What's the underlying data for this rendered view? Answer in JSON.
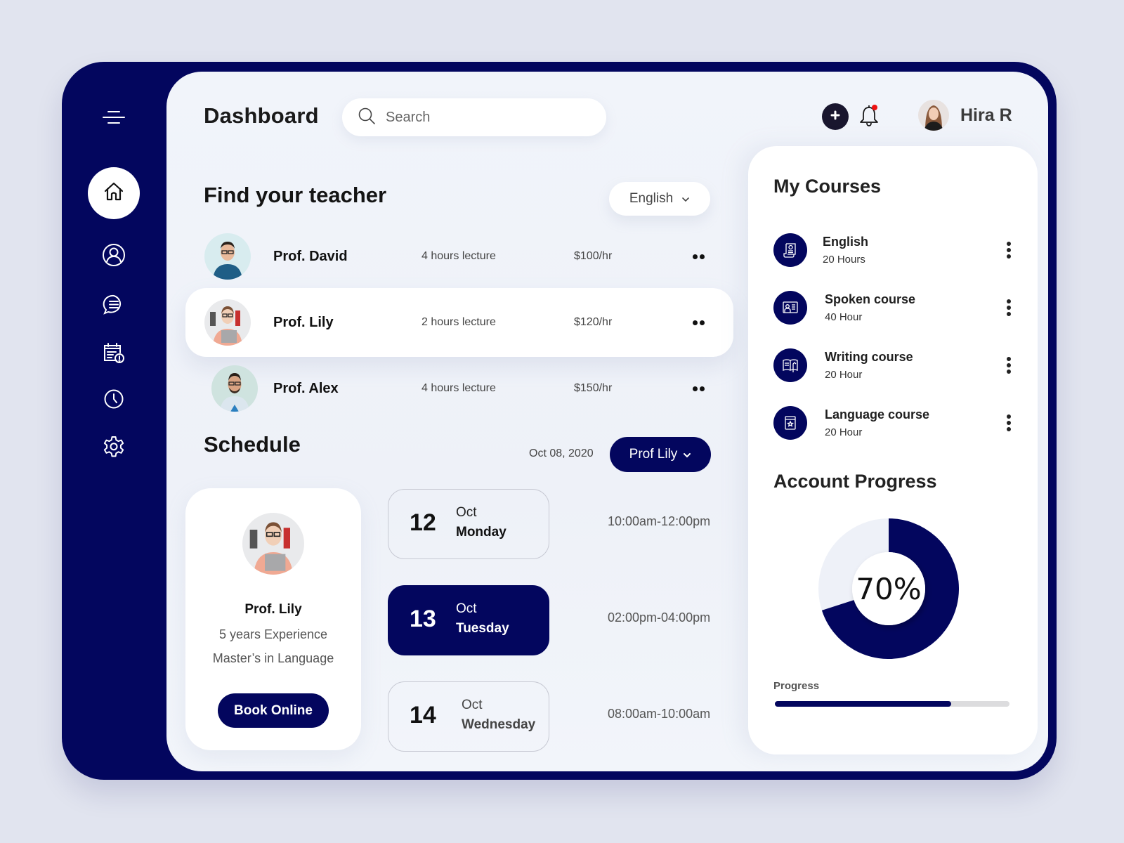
{
  "app": {
    "title": "Dashboard",
    "accent_color": "#03065e",
    "notification_color": "#ee1111"
  },
  "sidebar": {
    "items": [
      {
        "name": "menu",
        "icon": "hamburger-menu-icon"
      },
      {
        "name": "home",
        "icon": "home-icon",
        "active": true
      },
      {
        "name": "profile",
        "icon": "user-circle-icon"
      },
      {
        "name": "messages",
        "icon": "chat-bubble-icon"
      },
      {
        "name": "calendar",
        "icon": "calendar-info-icon"
      },
      {
        "name": "history",
        "icon": "clock-icon"
      },
      {
        "name": "settings",
        "icon": "gear-icon"
      }
    ]
  },
  "header": {
    "search_placeholder": "Search",
    "add_icon": "plus-icon",
    "notification_icon": "bell-icon",
    "user_name": "Hira R"
  },
  "teachers": {
    "title": "Find your teacher",
    "language_filter": "English",
    "list": [
      {
        "name": "Prof. David",
        "lecture": "4 hours lecture",
        "rate": "$100/hr",
        "active": false
      },
      {
        "name": "Prof. Lily",
        "lecture": "2 hours lecture",
        "rate": "$120/hr",
        "active": true
      },
      {
        "name": "Prof. Alex",
        "lecture": "4 hours lecture",
        "rate": "$150/hr",
        "active": false
      }
    ]
  },
  "schedule": {
    "title": "Schedule",
    "date": "Oct 08, 2020",
    "teacher_filter": "Prof Lily",
    "profile": {
      "name": "Prof. Lily",
      "experience": "5 years Experience",
      "degree": "Master’s in Language",
      "book_label": "Book Online"
    },
    "days": [
      {
        "day": "12",
        "month": "Oct",
        "weekday": "Monday",
        "time": "10:00am-12:00pm",
        "active": false
      },
      {
        "day": "13",
        "month": "Oct",
        "weekday": "Tuesday",
        "time": "02:00pm-04:00pm",
        "active": true
      },
      {
        "day": "14",
        "month": "Oct",
        "weekday": "Wednesday",
        "time": "08:00am-10:00am",
        "active": false
      }
    ]
  },
  "courses": {
    "title": "My Courses",
    "list": [
      {
        "name": "English",
        "hours": "20 Hours",
        "icon": "certificate-scroll-icon"
      },
      {
        "name": "Spoken course",
        "hours": "40 Hour",
        "icon": "presentation-board-icon"
      },
      {
        "name": "Writing course",
        "hours": "20 Hour",
        "icon": "open-book-pen-icon"
      },
      {
        "name": "Language course",
        "hours": "20 Hour",
        "icon": "star-book-icon"
      }
    ]
  },
  "progress": {
    "title": "Account Progress",
    "donut_percent": 70,
    "donut_label": "70%",
    "bar_label": "Progress",
    "bar_fraction": 0.75
  }
}
